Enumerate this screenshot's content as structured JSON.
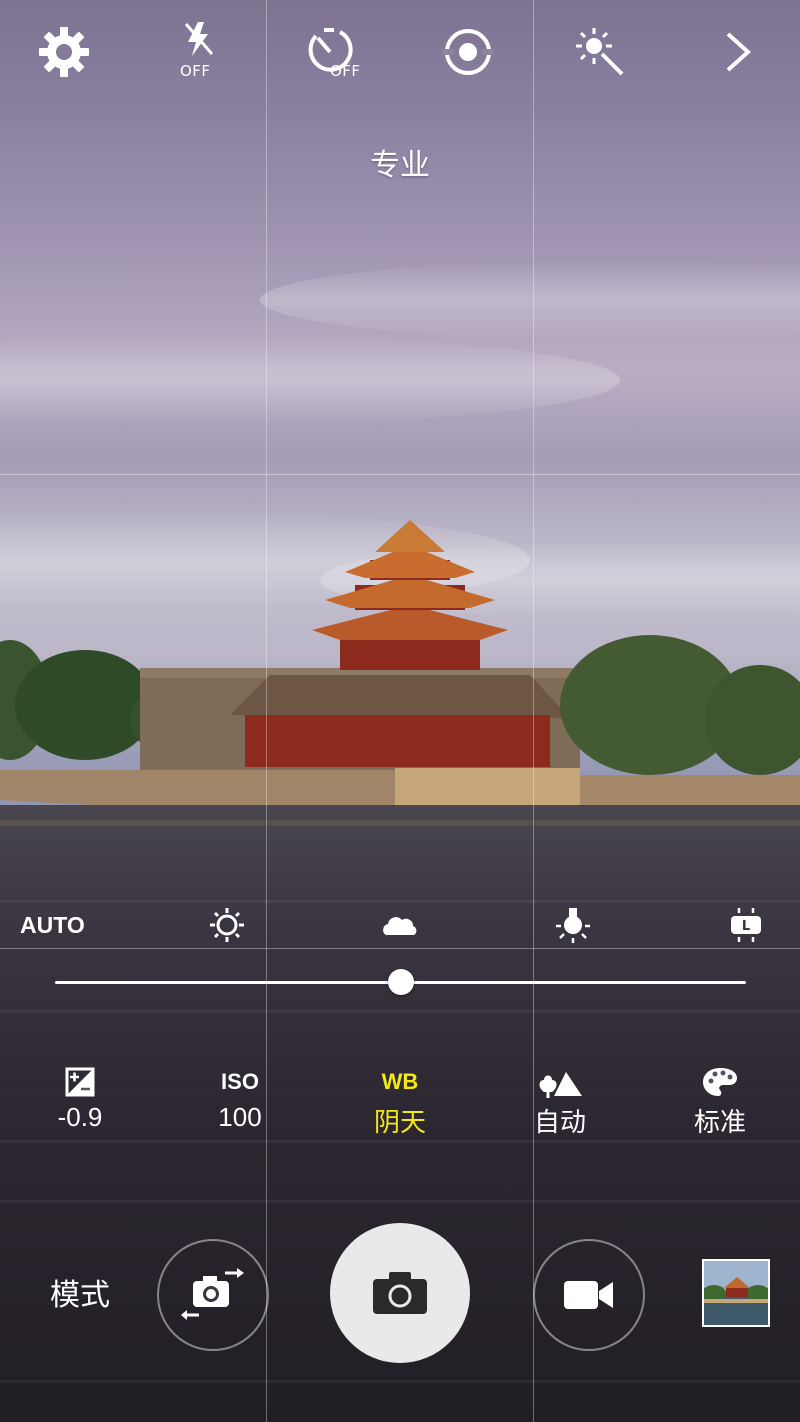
{
  "top_bar": {
    "flash_state": "OFF",
    "timer_state": "OFF",
    "icons": [
      "gear-icon",
      "flash-off-icon",
      "timer-off-icon",
      "focus-icon",
      "effects-icon",
      "chevron-right-icon"
    ]
  },
  "mode_title": "专业",
  "white_balance": {
    "auto_label": "AUTO",
    "presets": [
      "sun-icon",
      "cloud-icon",
      "bulb-icon",
      "fluorescent-icon"
    ],
    "level": 0.5
  },
  "params": {
    "exposure": {
      "icon": "exposure-icon",
      "value": "-0.9"
    },
    "iso": {
      "label": "ISO",
      "value": "100"
    },
    "wb": {
      "label": "WB",
      "value": "阴天"
    },
    "focus": {
      "icon": "focus-mountain-icon",
      "value": "自动"
    },
    "color": {
      "icon": "palette-icon",
      "value": "标准"
    }
  },
  "bottom_bar": {
    "mode_label": "模式",
    "icons": [
      "camera-switch-icon",
      "camera-icon",
      "video-icon"
    ]
  },
  "colors": {
    "active_accent": "#f3e81a",
    "shutter_bg": "#e9e9ea"
  }
}
